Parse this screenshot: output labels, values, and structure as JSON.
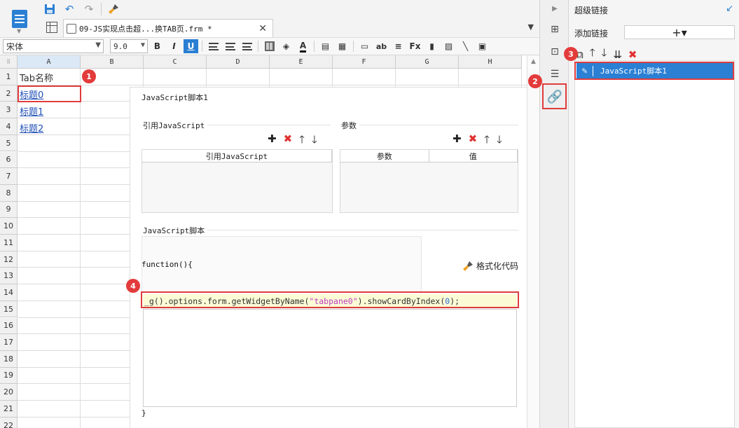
{
  "toolbar": {
    "save_icon": "save-icon",
    "undo_icon": "undo-icon",
    "redo_icon": "redo-icon",
    "clear_icon": "brush-icon"
  },
  "tab": {
    "label": "09-JS实现点击超...换TAB页.frm *",
    "close": "✕"
  },
  "format": {
    "font": "宋体",
    "size": "9.0",
    "bold": "B",
    "italic": "I",
    "underline": "U",
    "text_color_icon": "A"
  },
  "sheet": {
    "columns": [
      "A",
      "B",
      "C",
      "D",
      "E",
      "F",
      "G",
      "H"
    ],
    "rows": [
      "1",
      "2",
      "3",
      "4",
      "5",
      "6",
      "7",
      "8",
      "9",
      "10",
      "11",
      "12",
      "13",
      "14",
      "15",
      "16",
      "17",
      "18",
      "19",
      "20",
      "21",
      "22"
    ],
    "cells": {
      "a1": "Tab名称",
      "a2": "标题0",
      "a3": "标题1",
      "a4": "标题2"
    }
  },
  "dialog": {
    "title": "JavaScript脚本1",
    "ref_section": "引用JavaScript",
    "ref_column": "引用JavaScript",
    "param_section": "参数",
    "param_col_name": "参数",
    "param_col_value": "值",
    "script_section": "JavaScript脚本",
    "fn_open": "function(){",
    "format_code": "格式化代码",
    "code": {
      "p1": "_g().options.form.getWidgetByName(",
      "str": "\"tabpane0\"",
      "p2": ").showCardByIndex(",
      "num": "0",
      "p3": ");"
    },
    "fn_close": "}"
  },
  "panel": {
    "title": "超级链接",
    "add_label": "添加链接",
    "add_button": "+▾",
    "item_label": "JavaScript脚本1"
  },
  "markers": [
    "1",
    "2",
    "3",
    "4"
  ],
  "colors": {
    "accent": "#2b7fd3",
    "annotation_red": "#e03c3c",
    "delete_red": "#e03131"
  }
}
